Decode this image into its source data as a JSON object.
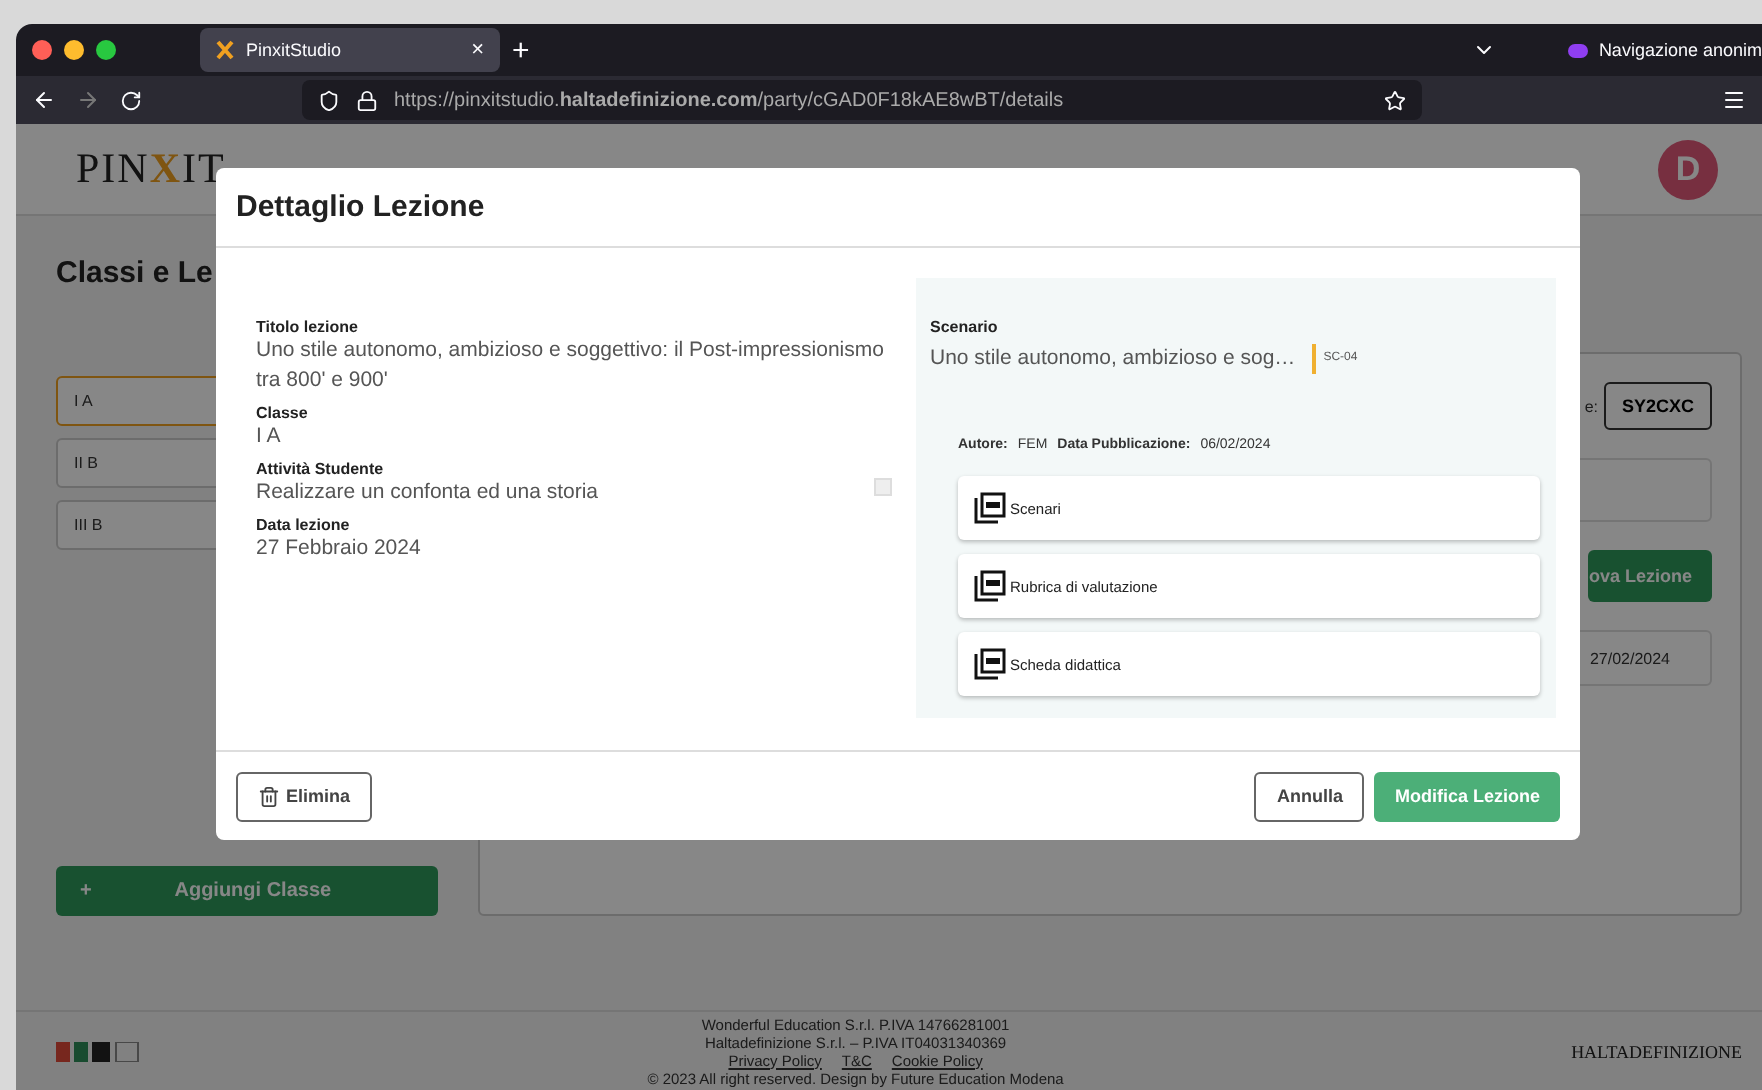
{
  "browser": {
    "tab_title": "PinxitStudio",
    "tab_close": "×",
    "new_tab": "+",
    "private_label": "Navigazione anonim",
    "url": "https://pinxitstudio.**haltadefinizione.com**/party/cGAD0F18kAE8wBT/details"
  },
  "header": {
    "logo_start": "PIN",
    "logo_mark": "X",
    "logo_end": "IT",
    "avatar": "D"
  },
  "page_title": "Classi e Le",
  "classes": [
    {
      "name": "I A",
      "selected": true
    },
    {
      "name": "II B",
      "selected": false
    },
    {
      "name": "III B",
      "selected": false
    }
  ],
  "add_class_button": {
    "icon": "+",
    "label": "Aggiungi Classe"
  },
  "class_panel": {
    "code_label": "e:",
    "code": "SY2CXC",
    "new_lesson_button": "ova Lezione",
    "lesson_date": "27/02/2024"
  },
  "modal": {
    "title": "Dettaglio Lezione",
    "fields": [
      {
        "label": "Titolo lezione",
        "value": "Uno stile autonomo, ambizioso e soggettivo: il Post-impressionismo tra 800' e 900'"
      },
      {
        "label": "Classe",
        "value": "I A"
      },
      {
        "label": "Attività Studente",
        "value": "Realizzare un confonta ed una storia"
      },
      {
        "label": "Data lezione",
        "value": "27 Febbraio 2024"
      }
    ],
    "scenario": {
      "label": "Scenario",
      "value": "Uno stile autonomo, ambizioso e sog…",
      "tag": "SC-04",
      "author_label": "Autore:",
      "author": "FEM",
      "date_label": "Data Pubblicazione:",
      "date": "06/02/2024"
    },
    "documents": [
      "Scenari",
      "Rubrica di valutazione",
      "Scheda didattica"
    ],
    "delete_button": "Elimina",
    "cancel_button": "Annulla",
    "edit_button": "Modifica Lezione"
  },
  "footer": {
    "lines": [
      "Wonderful Education S.r.l. P.IVA 14766281001",
      "Haltadefinizione S.r.l. – P.IVA IT04031340369"
    ],
    "links": [
      "Privacy Policy",
      "T&C",
      "Cookie Policy"
    ],
    "copyright": "© 2023 All right reserved. Design by Future Education Modena",
    "brand": "HALTADEFINIZIONE"
  }
}
